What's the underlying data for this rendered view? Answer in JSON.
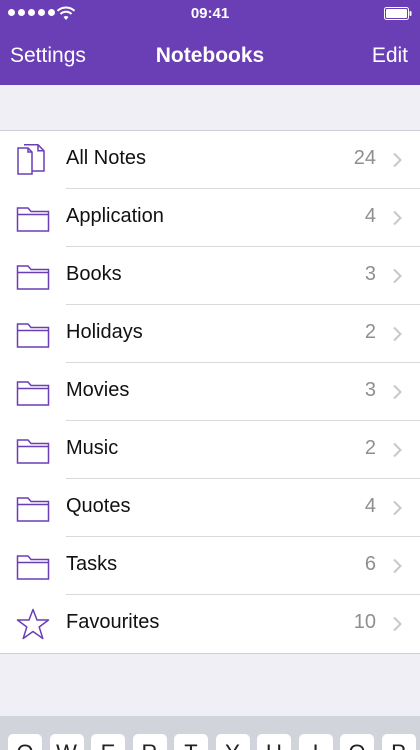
{
  "status_bar": {
    "time": "09:41",
    "signal_dots": 5,
    "icons": [
      "signal-icon",
      "wifi-icon",
      "battery-icon"
    ]
  },
  "nav": {
    "left_label": "Settings",
    "title": "Notebooks",
    "right_label": "Edit"
  },
  "notebooks": [
    {
      "label": "All Notes",
      "count": "24",
      "icon": "notes-icon"
    },
    {
      "label": "Application",
      "count": "4",
      "icon": "folder-icon"
    },
    {
      "label": "Books",
      "count": "3",
      "icon": "folder-icon"
    },
    {
      "label": "Holidays",
      "count": "2",
      "icon": "folder-icon"
    },
    {
      "label": "Movies",
      "count": "3",
      "icon": "folder-icon"
    },
    {
      "label": "Music",
      "count": "2",
      "icon": "folder-icon"
    },
    {
      "label": "Quotes",
      "count": "4",
      "icon": "folder-icon"
    },
    {
      "label": "Tasks",
      "count": "6",
      "icon": "folder-icon"
    },
    {
      "label": "Favourites",
      "count": "10",
      "icon": "star-icon"
    }
  ],
  "keyboard": {
    "keys": [
      "Q",
      "W",
      "E",
      "R",
      "T",
      "Y",
      "U",
      "I",
      "O",
      "P"
    ]
  },
  "colors": {
    "accent": "#6a3fb5",
    "background": "#f0eff5",
    "count_text": "#8e8e93"
  }
}
